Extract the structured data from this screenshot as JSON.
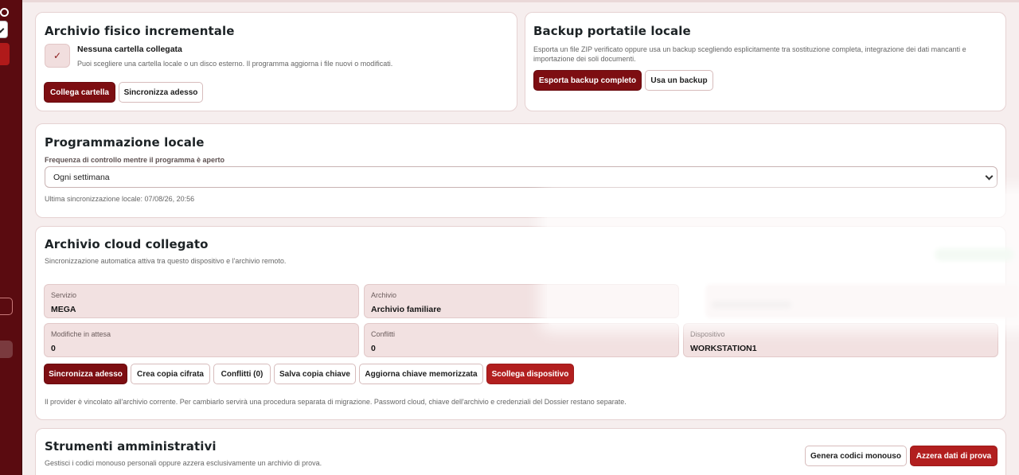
{
  "incremental_archive": {
    "title": "Archivio fisico incrementale",
    "status_title": "Nessuna cartella collegata",
    "status_desc": "Puoi scegliere una cartella locale o un disco esterno. Il programma aggiorna i file nuovi o modificati.",
    "check_glyph": "✓",
    "connect_label": "Collega cartella",
    "sync_label": "Sincronizza adesso"
  },
  "portable_backup": {
    "title": "Backup portatile locale",
    "description": "Esporta un file ZIP verificato oppure usa un backup scegliendo esplicitamente tra sostituzione completa, integrazione dei dati mancanti e importazione dei soli documenti.",
    "export_label": "Esporta backup completo",
    "use_label": "Usa un backup"
  },
  "scheduling": {
    "title": "Programmazione locale",
    "frequency_label": "Frequenza di controllo mentre il programma è aperto",
    "frequency_value": "Ogni settimana",
    "last_sync": "Ultima sincronizzazione locale: 07/08/26, 20:56"
  },
  "cloud": {
    "title": "Archivio cloud collegato",
    "subtitle": "Sincronizzazione automatica attiva tra questo dispositivo e l'archivio remoto.",
    "fields": {
      "service_label": "Servizio",
      "service_value": "MEGA",
      "archive_label": "Archivio",
      "archive_value": "Archivio familiare",
      "pending_label": "Modifiche in attesa",
      "pending_value": "0",
      "conflicts_label": "Conflitti",
      "conflicts_value": "0",
      "device_label": "Dispositivo",
      "device_value": "WORKSTATION1"
    },
    "buttons": {
      "sync": "Sincronizza adesso",
      "encrypted_copy": "Crea copia cifrata",
      "conflicts": "Conflitti (0)",
      "save_key": "Salva copia chiave",
      "update_key": "Aggiorna chiave memorizzata",
      "disconnect": "Scollega dispositivo"
    },
    "note": "Il provider è vincolato all'archivio corrente. Per cambiarlo servirà una procedura separata di migrazione. Password cloud, chiave dell'archivio e credenziali del Dossier restano separate."
  },
  "admin": {
    "title": "Strumenti amministrativi",
    "subtitle": "Gestisci i codici monouso personali oppure azzera esclusivamente un archivio di prova.",
    "generate_label": "Genera codici monouso",
    "reset_label": "Azzera dati di prova"
  },
  "colors": {
    "accent_dark": "#7d0e12",
    "accent_red": "#b21f1f",
    "sidebar": "#5a0b10",
    "field_bg": "#f2e1e1"
  }
}
